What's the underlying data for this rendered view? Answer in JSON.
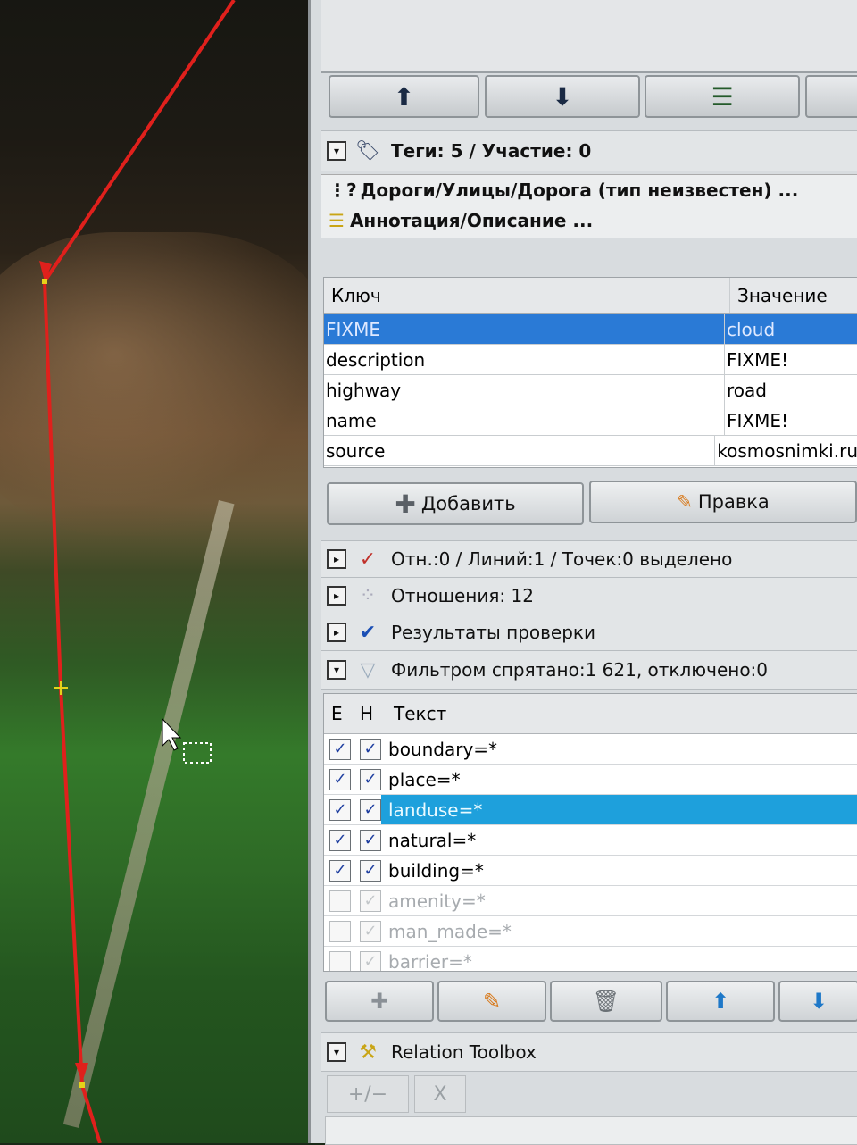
{
  "tags_section": {
    "title": "Теги: 5 / Участие: 0"
  },
  "presets": [
    {
      "label": "Дороги/Улицы/Дорога (тип неизвестен) ..."
    },
    {
      "label": "Аннотация/Описание ..."
    }
  ],
  "tag_table": {
    "columns": [
      "Ключ",
      "Значение"
    ],
    "rows": [
      {
        "key": "FIXME",
        "value": "cloud"
      },
      {
        "key": "description",
        "value": "FIXME!"
      },
      {
        "key": "highway",
        "value": "road"
      },
      {
        "key": "name",
        "value": "FIXME!"
      },
      {
        "key": "source",
        "value": "kosmosnimki.ru"
      }
    ],
    "selected_row": 0
  },
  "tag_buttons": {
    "add": "Добавить",
    "edit": "Правка"
  },
  "sections": {
    "selection": "Отн.:0 / Линий:1 / Точек:0 выделено",
    "relations": "Отношения: 12",
    "validation": "Результаты проверки",
    "filter": "Фильтром спрятано:1 621, отключено:0",
    "relation_toolbox": "Relation Toolbox"
  },
  "filter_table": {
    "columns": [
      "E",
      "H",
      "Текст"
    ],
    "rows": [
      {
        "text": "boundary=*",
        "enabled": true,
        "hide": true
      },
      {
        "text": "place=*",
        "enabled": true,
        "hide": true
      },
      {
        "text": "landuse=*",
        "enabled": true,
        "hide": true
      },
      {
        "text": "natural=*",
        "enabled": true,
        "hide": true
      },
      {
        "text": "building=*",
        "enabled": true,
        "hide": true
      },
      {
        "text": "amenity=*",
        "enabled": false,
        "hide": false
      },
      {
        "text": "man_made=*",
        "enabled": false,
        "hide": false
      },
      {
        "text": "barrier=*",
        "enabled": false,
        "hide": false
      }
    ],
    "selected_row": 2
  },
  "toolbox_buttons": {
    "add_remove": "+/−",
    "remove": "X"
  },
  "colors": {
    "selection_blue": "#2a7ad6",
    "filter_selection": "#1ea0dc",
    "way_red": "#e0201c"
  }
}
